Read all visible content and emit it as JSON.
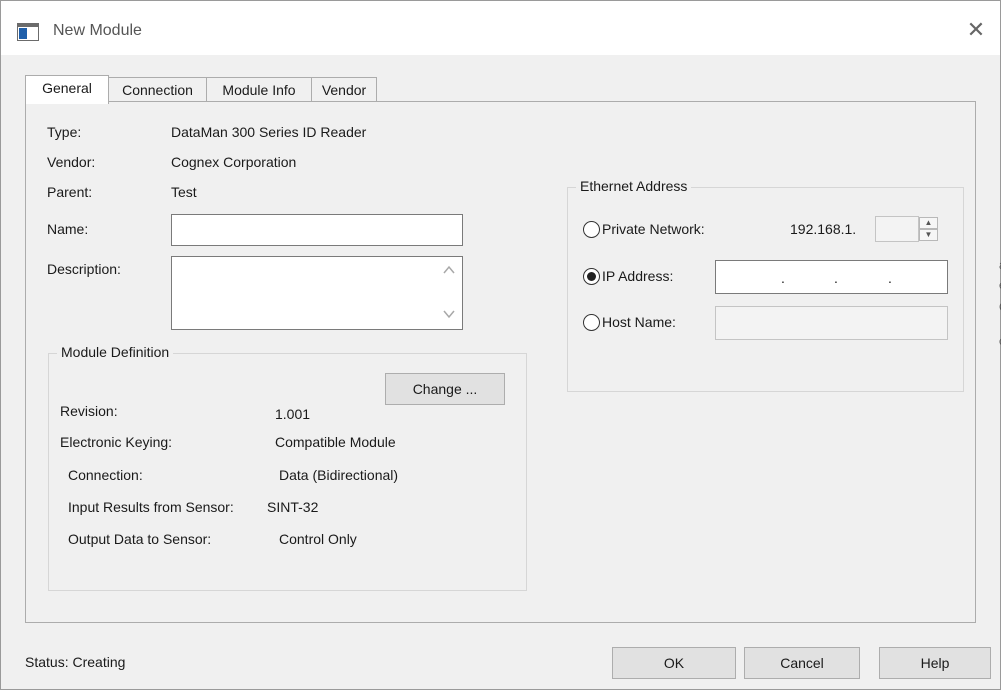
{
  "window": {
    "title": "New Module",
    "close_symbol": "✕"
  },
  "tabs": [
    {
      "label": "General",
      "active": true
    },
    {
      "label": "Connection",
      "active": false
    },
    {
      "label": "Module Info",
      "active": false
    },
    {
      "label": "Vendor",
      "active": false
    }
  ],
  "general": {
    "type_label": "Type:",
    "type_value": "DataMan 300 Series ID Reader",
    "vendor_label": "Vendor:",
    "vendor_value": "Cognex Corporation",
    "parent_label": "Parent:",
    "parent_value": "Test",
    "name_label": "Name:",
    "name_value": "",
    "description_label": "Description:",
    "description_value": ""
  },
  "module_definition": {
    "title": "Module Definition",
    "change_button": "Change ...",
    "revision_label": "Revision:",
    "revision_value": "1.001",
    "keying_label": "Electronic Keying:",
    "keying_value": "Compatible Module",
    "connection_label": "Connection:",
    "connection_value": "Data (Bidirectional)",
    "input_label": "Input Results from Sensor:",
    "input_value": "SINT-32",
    "output_label": "Output Data to Sensor:",
    "output_value": "Control Only"
  },
  "ethernet": {
    "title": "Ethernet Address",
    "private_label": "Private Network:",
    "private_prefix": "192.168.1.",
    "private_selected": false,
    "ip_label": "IP Address:",
    "ip_selected": true,
    "ip_dot": ".",
    "host_label": "Host Name:",
    "host_selected": false,
    "host_value": ""
  },
  "footer": {
    "status": "Status:  Creating",
    "ok_button": "OK",
    "cancel_button": "Cancel",
    "help_button": "Help"
  },
  "icons": {
    "app": "window-icon",
    "close": "close-icon",
    "scroll_up": "chevron-up-icon",
    "scroll_down": "chevron-down-icon",
    "spin_up": "triangle-up-icon",
    "spin_down": "triangle-down-icon"
  },
  "background_edge_glyphs": [
    "a",
    "e",
    "C",
    "c"
  ]
}
